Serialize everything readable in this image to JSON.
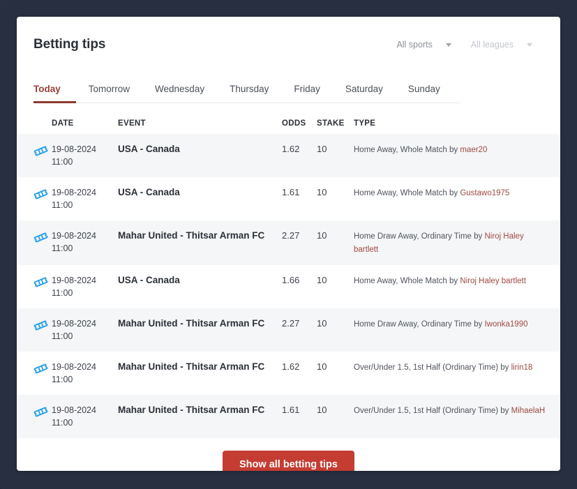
{
  "theme": {
    "page_background": "#272f40",
    "card_background": "#ffffff",
    "accent_red": "#c43c32",
    "tab_active_color": "#9b3f36",
    "tab_underline_color": "#8b3a32",
    "username_link_color": "#a04a42",
    "ticket_icon_color": "#1f9eea",
    "row_stripe_color": "#f5f6f7"
  },
  "header": {
    "title": "Betting tips",
    "filters": [
      {
        "label": "All sports",
        "state": "active",
        "icon": "chevron-down-icon"
      },
      {
        "label": "All leagues",
        "state": "muted",
        "icon": "chevron-down-icon"
      }
    ]
  },
  "tabs": [
    {
      "label": "Today",
      "active": true
    },
    {
      "label": "Tomorrow",
      "active": false
    },
    {
      "label": "Wednesday",
      "active": false
    },
    {
      "label": "Thursday",
      "active": false
    },
    {
      "label": "Friday",
      "active": false
    },
    {
      "label": "Saturday",
      "active": false
    },
    {
      "label": "Sunday",
      "active": false
    }
  ],
  "table": {
    "columns": [
      "DATE",
      "EVENT",
      "ODDS",
      "STAKE",
      "TYPE"
    ],
    "rows": [
      {
        "icon": "ticket-icon",
        "date": "19-08-2024",
        "time": "11:00",
        "event": "USA - Canada",
        "odds": "1.62",
        "stake": "10",
        "type_text": "Home Away, Whole Match by ",
        "type_user": "maer20"
      },
      {
        "icon": "ticket-icon",
        "date": "19-08-2024",
        "time": "11:00",
        "event": "USA - Canada",
        "odds": "1.61",
        "stake": "10",
        "type_text": "Home Away, Whole Match by ",
        "type_user": "Gustawo1975"
      },
      {
        "icon": "ticket-icon",
        "date": "19-08-2024",
        "time": "11:00",
        "event": "Mahar United - Thitsar Arman FC",
        "odds": "2.27",
        "stake": "10",
        "type_text": "Home Draw Away, Ordinary Time by ",
        "type_user": "Niroj Haley bartlett"
      },
      {
        "icon": "ticket-icon",
        "date": "19-08-2024",
        "time": "11:00",
        "event": "USA - Canada",
        "odds": "1.66",
        "stake": "10",
        "type_text": "Home Away, Whole Match by ",
        "type_user": "Niroj Haley bartlett"
      },
      {
        "icon": "ticket-icon",
        "date": "19-08-2024",
        "time": "11:00",
        "event": "Mahar United - Thitsar Arman FC",
        "odds": "2.27",
        "stake": "10",
        "type_text": "Home Draw Away, Ordinary Time by ",
        "type_user": "Iwonka1990"
      },
      {
        "icon": "ticket-icon",
        "date": "19-08-2024",
        "time": "11:00",
        "event": "Mahar United - Thitsar Arman FC",
        "odds": "1.62",
        "stake": "10",
        "type_text": "Over/Under 1.5, 1st Half (Ordinary Time) by ",
        "type_user": "lirin18"
      },
      {
        "icon": "ticket-icon",
        "date": "19-08-2024",
        "time": "11:00",
        "event": "Mahar United - Thitsar Arman FC",
        "odds": "1.61",
        "stake": "10",
        "type_text": "Over/Under 1.5, 1st Half (Ordinary Time) by ",
        "type_user": "MihaelaH"
      }
    ]
  },
  "footer": {
    "show_all_label": "Show all betting tips"
  }
}
